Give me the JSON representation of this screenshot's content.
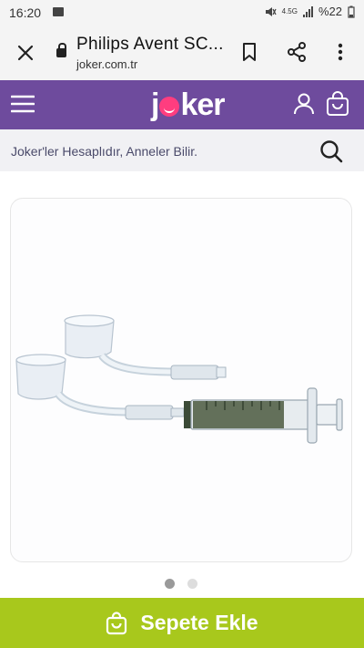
{
  "status_bar": {
    "time": "16:20",
    "network": "4.5G",
    "battery": "%22"
  },
  "browser": {
    "title": "Philips Avent SC...",
    "domain": "joker.com.tr"
  },
  "nav": {
    "logo_text_start": "j",
    "logo_text_end": "ker",
    "brand_color": "#6e4b9d",
    "logo_dot_color": "#ff3d7f"
  },
  "search": {
    "placeholder": "Joker'ler Hesaplıdır, Anneler Bilir."
  },
  "gallery": {
    "total_images": 2,
    "active_index": 1,
    "active_dot_color": "#9a9a9a",
    "inactive_dot_color": "#dddddd"
  },
  "cart": {
    "button_label": "Sepete Ekle",
    "button_color": "#a8c81c"
  },
  "icons": [
    "close-icon",
    "lock-icon",
    "bookmark-icon",
    "share-icon",
    "more-vert-icon",
    "menu-icon",
    "user-icon",
    "cart-icon",
    "search-icon",
    "shopping-bag-icon"
  ]
}
